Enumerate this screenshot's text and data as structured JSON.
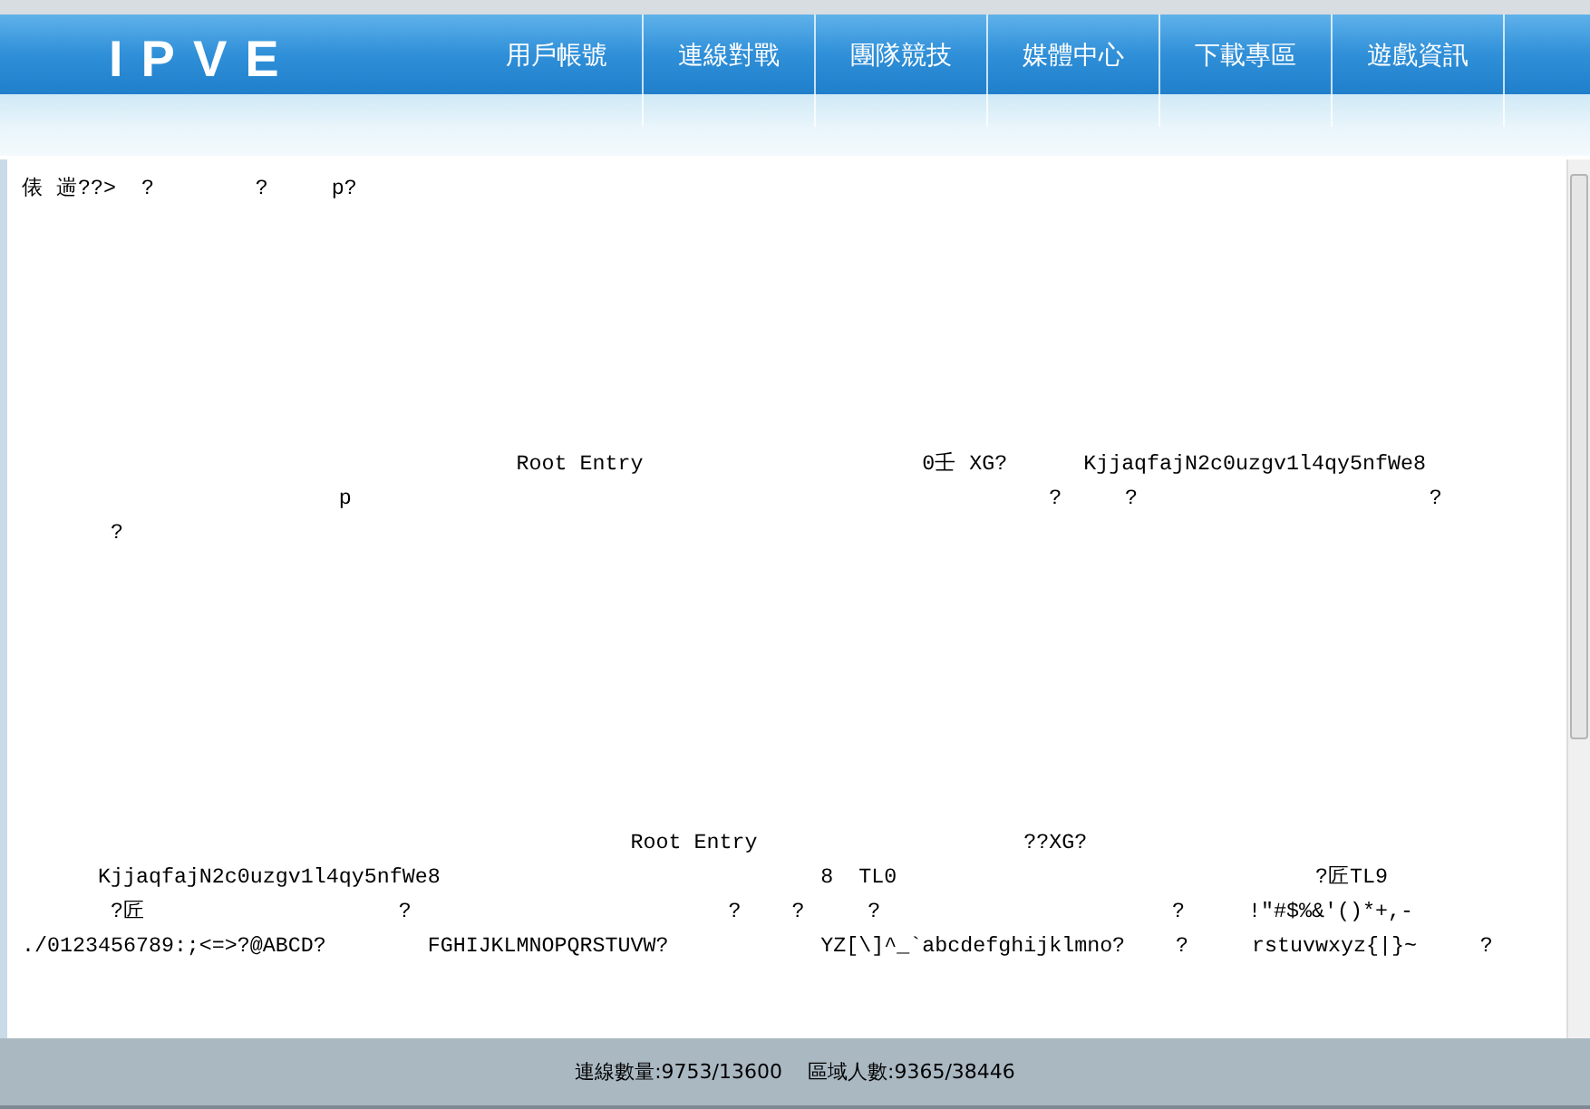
{
  "header": {
    "logo": "IPVE",
    "nav": [
      "用戶帳號",
      "連線對戰",
      "團隊競技",
      "媒體中心",
      "下載專區",
      "遊戲資訊"
    ]
  },
  "content": {
    "blocks": [
      [
        "俵 遄??>  ?        ?     p?"
      ],
      [
        "                                       Root Entry                      0壬 XG?      KjjaqfajN2c0uzgv1l4qy5nfWe8",
        "                         p                                                       ?     ?                       ?",
        "       ?"
      ],
      [
        "                                                Root Entry                     ??XG?",
        "      KjjaqfajN2c0uzgv1l4qy5nfWe8                              8  TL0                                 ?匠TL9",
        "       ?匠                    ?                         ?    ?     ?                       ?     !\"#$%&'()*+,-",
        "./0123456789:;<=>?@ABCD?        FGHIJKLMNOPQRSTUVW?            YZ[\\]^_`abcdefghijklmno?    ?     rstuvwxyz{|}~     ?"
      ]
    ]
  },
  "status_bar": [
    "連線數量:9753/13600",
    "區域人數:9365/38446"
  ]
}
